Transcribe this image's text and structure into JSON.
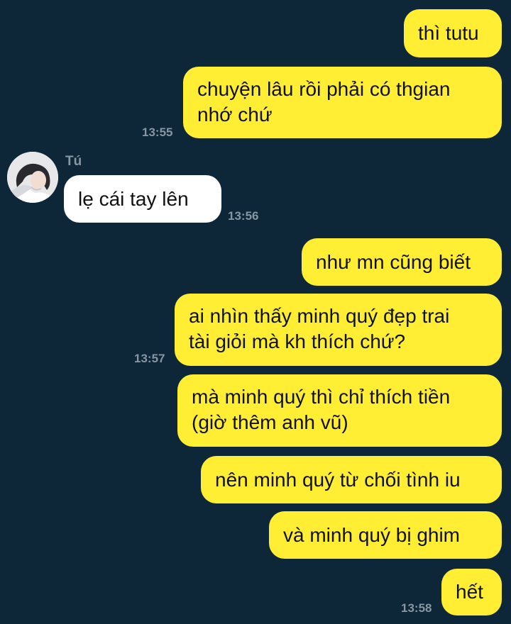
{
  "conversation": {
    "contact_name": "Tú",
    "messages": [
      {
        "sender": "me",
        "lines": [
          "thì tutu"
        ]
      },
      {
        "sender": "me",
        "lines": [
          "chuyện lâu rồi phải có thgian",
          "nhớ chứ"
        ],
        "time": "13:55"
      },
      {
        "sender": "Tú",
        "lines": [
          "lẹ cái tay lên"
        ],
        "time": "13:56"
      },
      {
        "sender": "me",
        "lines": [
          "như mn cũng biết"
        ]
      },
      {
        "sender": "me",
        "lines": [
          "ai nhìn thấy minh quý đẹp trai",
          "tài giỏi mà kh thích chứ?"
        ],
        "time": "13:57"
      },
      {
        "sender": "me",
        "lines": [
          "mà minh quý thì chỉ thích tiền",
          "(giờ thêm anh vũ)"
        ]
      },
      {
        "sender": "me",
        "lines": [
          "nên minh quý từ chối tình iu"
        ]
      },
      {
        "sender": "me",
        "lines": [
          "và minh quý bị ghim"
        ]
      },
      {
        "sender": "me",
        "lines": [
          "hết"
        ],
        "time": "13:58"
      }
    ]
  },
  "colors": {
    "background": "#0d2638",
    "outgoing_bubble": "#ffee33",
    "incoming_bubble": "#ffffff",
    "timestamp": "#8696a3"
  },
  "icons": {
    "contact_avatar": "avatar"
  }
}
